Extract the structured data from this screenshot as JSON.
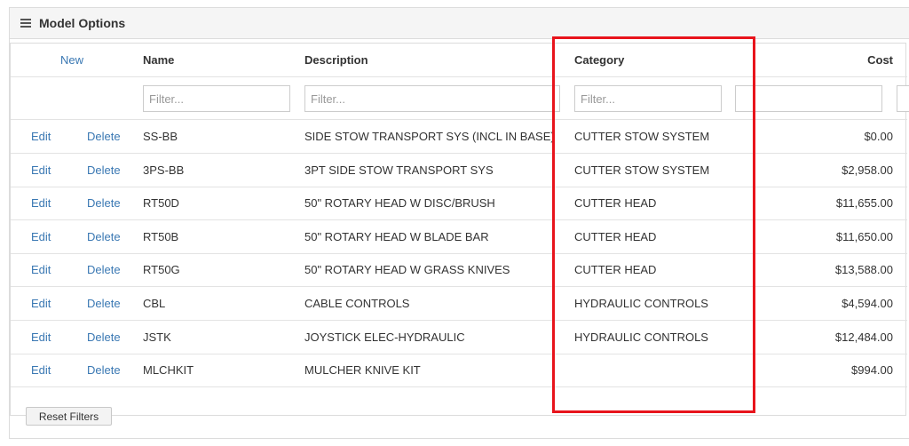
{
  "panel": {
    "title": "Model Options"
  },
  "grid": {
    "columns": {
      "new": "New",
      "name": "Name",
      "description": "Description",
      "category": "Category",
      "cost": "Cost"
    },
    "filters": {
      "name": "Filter...",
      "description": "Filter...",
      "category": "Filter...",
      "cost": ""
    },
    "actions": {
      "edit": "Edit",
      "delete": "Delete"
    },
    "rows": [
      {
        "name": "SS-BB",
        "description": "SIDE STOW TRANSPORT SYS (INCL IN BASE)",
        "category": "CUTTER STOW SYSTEM",
        "cost": "$0.00"
      },
      {
        "name": "3PS-BB",
        "description": "3PT SIDE STOW TRANSPORT SYS",
        "category": "CUTTER STOW SYSTEM",
        "cost": "$2,958.00"
      },
      {
        "name": "RT50D",
        "description": "50\" ROTARY HEAD W DISC/BRUSH",
        "category": "CUTTER HEAD",
        "cost": "$11,655.00"
      },
      {
        "name": "RT50B",
        "description": "50\" ROTARY HEAD W BLADE BAR",
        "category": "CUTTER HEAD",
        "cost": "$11,650.00"
      },
      {
        "name": "RT50G",
        "description": "50\" ROTARY HEAD W GRASS KNIVES",
        "category": "CUTTER HEAD",
        "cost": "$13,588.00"
      },
      {
        "name": "CBL",
        "description": "CABLE CONTROLS",
        "category": "HYDRAULIC CONTROLS",
        "cost": "$4,594.00"
      },
      {
        "name": "JSTK",
        "description": "JOYSTICK ELEC-HYDRAULIC",
        "category": "HYDRAULIC CONTROLS",
        "cost": "$12,484.00"
      },
      {
        "name": "MLCHKIT",
        "description": "MULCHER KNIVE KIT",
        "category": "",
        "cost": "$994.00"
      }
    ]
  },
  "footer": {
    "reset_label": "Reset Filters"
  },
  "colors": {
    "link": "#3a78b3",
    "highlight": "#e8141c"
  }
}
